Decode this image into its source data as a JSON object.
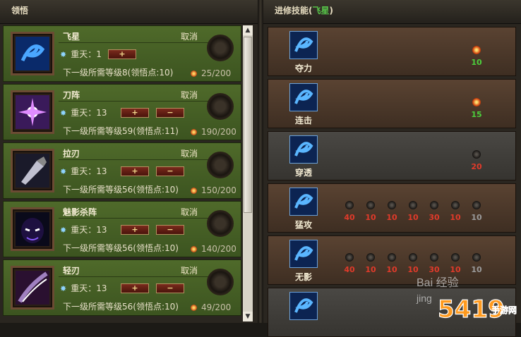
{
  "left_panel": {
    "title": "领悟"
  },
  "right_panel": {
    "title_prefix": "进修技能(",
    "title_highlight": "飞星",
    "title_suffix": ")"
  },
  "skills": [
    {
      "name": "飞星",
      "cancel": "取消",
      "tier_label": "重天：1",
      "plus": "+",
      "minus": "",
      "requirement": "下一级所需等级8(领悟点:10)",
      "points": "25/200"
    },
    {
      "name": "刀阵",
      "cancel": "取消",
      "tier_label": "重天：13",
      "plus": "+",
      "minus": "−",
      "requirement": "下一级所需等级59(领悟点:11)",
      "points": "190/200"
    },
    {
      "name": "拉刃",
      "cancel": "取消",
      "tier_label": "重天：13",
      "plus": "+",
      "minus": "−",
      "requirement": "下一级所需等级56(领悟点:10)",
      "points": "150/200"
    },
    {
      "name": "魅影杀阵",
      "cancel": "取消",
      "tier_label": "重天：13",
      "plus": "+",
      "minus": "−",
      "requirement": "下一级所需等级56(领悟点:10)",
      "points": "140/200"
    },
    {
      "name": "轻刃",
      "cancel": "取消",
      "tier_label": "重天：13",
      "plus": "+",
      "minus": "−",
      "requirement": "下一级所需等级56(领悟点:10)",
      "points": "49/200"
    }
  ],
  "advanced": [
    {
      "name": "夺力",
      "style": "brown",
      "slots": [
        {
          "v": "10",
          "lit": true,
          "color": "#4ccf3c"
        }
      ]
    },
    {
      "name": "连击",
      "style": "brown",
      "slots": [
        {
          "v": "15",
          "lit": true,
          "color": "#4ccf3c"
        }
      ]
    },
    {
      "name": "穿透",
      "style": "gray",
      "slots": [
        {
          "v": "20",
          "lit": false,
          "color": "#e03a2a"
        }
      ]
    },
    {
      "name": "猛攻",
      "style": "brown",
      "slots": [
        {
          "v": "40",
          "lit": false,
          "color": "#e03a2a"
        },
        {
          "v": "10",
          "lit": false,
          "color": "#e03a2a"
        },
        {
          "v": "10",
          "lit": false,
          "color": "#e03a2a"
        },
        {
          "v": "10",
          "lit": false,
          "color": "#e03a2a"
        },
        {
          "v": "30",
          "lit": false,
          "color": "#e03a2a"
        },
        {
          "v": "10",
          "lit": false,
          "color": "#e03a2a"
        },
        {
          "v": "10",
          "lit": false,
          "color": "#9a9a9a"
        }
      ]
    },
    {
      "name": "无影",
      "style": "brown",
      "slots": [
        {
          "v": "40",
          "lit": false,
          "color": "#e03a2a"
        },
        {
          "v": "10",
          "lit": false,
          "color": "#e03a2a"
        },
        {
          "v": "10",
          "lit": false,
          "color": "#e03a2a"
        },
        {
          "v": "10",
          "lit": false,
          "color": "#e03a2a"
        },
        {
          "v": "30",
          "lit": false,
          "color": "#e03a2a"
        },
        {
          "v": "10",
          "lit": false,
          "color": "#e03a2a"
        },
        {
          "v": "10",
          "lit": false,
          "color": "#9a9a9a"
        }
      ]
    },
    {
      "name": "",
      "style": "gray",
      "slots": []
    }
  ],
  "scrollbar": {
    "up": "▲",
    "down": "▼"
  },
  "watermark": {
    "text": "Bai 经验 jing 手游网",
    "logo": "5419"
  }
}
